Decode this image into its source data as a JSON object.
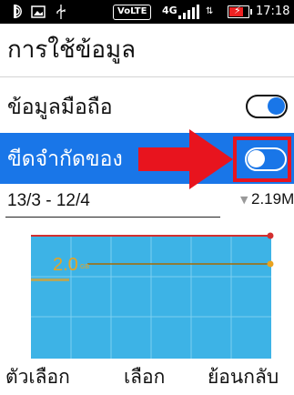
{
  "status_bar": {
    "icons": [
      "voice-call-icon",
      "screenshot-icon",
      "usb-icon"
    ],
    "volte": "VoLTE",
    "network": "4G",
    "time": "17:18",
    "battery_color": "#e22222"
  },
  "header": {
    "title": "การใช้ข้อมูล"
  },
  "settings": {
    "mobile_data": {
      "label": "ข้อมูลมือถือ",
      "enabled": true
    },
    "limit_data": {
      "label": "ขีดจำกัดของ",
      "enabled": false
    }
  },
  "cycle": {
    "date_range": "13/3 - 12/4",
    "usage": "2.19MB"
  },
  "chart_data": {
    "type": "area",
    "limit_line": {
      "color": "#d32f2f"
    },
    "warning_line": {
      "value_label": "2.0",
      "unit": "GB",
      "color": "#e9a31f"
    }
  },
  "bottom_nav": {
    "options": "ตัวเลือก",
    "select": "เลือก",
    "back": "ย้อนกลับ"
  },
  "colors": {
    "accent": "#1976e8",
    "annotation_red": "#e8141e",
    "chart_fill": "#3db3e6"
  }
}
